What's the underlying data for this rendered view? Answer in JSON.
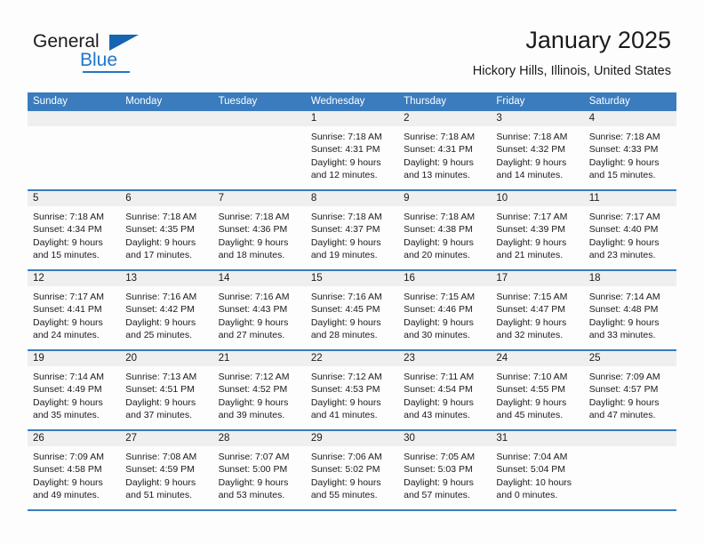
{
  "brand": {
    "name_part1": "General",
    "name_part2": "Blue",
    "logo_icon": "triangle-icon"
  },
  "header": {
    "title": "January 2025",
    "subtitle": "Hickory Hills, Illinois, United States"
  },
  "colors": {
    "header_blue": "#3a7cbe",
    "brand_blue": "#2076c9",
    "date_strip_gray": "#efefef",
    "text": "#1b1b1b"
  },
  "weekdays": [
    "Sunday",
    "Monday",
    "Tuesday",
    "Wednesday",
    "Thursday",
    "Friday",
    "Saturday"
  ],
  "weeks": [
    [
      {
        "date": "",
        "sunrise": "",
        "sunset": "",
        "daylight_line1": "",
        "daylight_line2": ""
      },
      {
        "date": "",
        "sunrise": "",
        "sunset": "",
        "daylight_line1": "",
        "daylight_line2": ""
      },
      {
        "date": "",
        "sunrise": "",
        "sunset": "",
        "daylight_line1": "",
        "daylight_line2": ""
      },
      {
        "date": "1",
        "sunrise": "Sunrise: 7:18 AM",
        "sunset": "Sunset: 4:31 PM",
        "daylight_line1": "Daylight: 9 hours",
        "daylight_line2": "and 12 minutes."
      },
      {
        "date": "2",
        "sunrise": "Sunrise: 7:18 AM",
        "sunset": "Sunset: 4:31 PM",
        "daylight_line1": "Daylight: 9 hours",
        "daylight_line2": "and 13 minutes."
      },
      {
        "date": "3",
        "sunrise": "Sunrise: 7:18 AM",
        "sunset": "Sunset: 4:32 PM",
        "daylight_line1": "Daylight: 9 hours",
        "daylight_line2": "and 14 minutes."
      },
      {
        "date": "4",
        "sunrise": "Sunrise: 7:18 AM",
        "sunset": "Sunset: 4:33 PM",
        "daylight_line1": "Daylight: 9 hours",
        "daylight_line2": "and 15 minutes."
      }
    ],
    [
      {
        "date": "5",
        "sunrise": "Sunrise: 7:18 AM",
        "sunset": "Sunset: 4:34 PM",
        "daylight_line1": "Daylight: 9 hours",
        "daylight_line2": "and 15 minutes."
      },
      {
        "date": "6",
        "sunrise": "Sunrise: 7:18 AM",
        "sunset": "Sunset: 4:35 PM",
        "daylight_line1": "Daylight: 9 hours",
        "daylight_line2": "and 17 minutes."
      },
      {
        "date": "7",
        "sunrise": "Sunrise: 7:18 AM",
        "sunset": "Sunset: 4:36 PM",
        "daylight_line1": "Daylight: 9 hours",
        "daylight_line2": "and 18 minutes."
      },
      {
        "date": "8",
        "sunrise": "Sunrise: 7:18 AM",
        "sunset": "Sunset: 4:37 PM",
        "daylight_line1": "Daylight: 9 hours",
        "daylight_line2": "and 19 minutes."
      },
      {
        "date": "9",
        "sunrise": "Sunrise: 7:18 AM",
        "sunset": "Sunset: 4:38 PM",
        "daylight_line1": "Daylight: 9 hours",
        "daylight_line2": "and 20 minutes."
      },
      {
        "date": "10",
        "sunrise": "Sunrise: 7:17 AM",
        "sunset": "Sunset: 4:39 PM",
        "daylight_line1": "Daylight: 9 hours",
        "daylight_line2": "and 21 minutes."
      },
      {
        "date": "11",
        "sunrise": "Sunrise: 7:17 AM",
        "sunset": "Sunset: 4:40 PM",
        "daylight_line1": "Daylight: 9 hours",
        "daylight_line2": "and 23 minutes."
      }
    ],
    [
      {
        "date": "12",
        "sunrise": "Sunrise: 7:17 AM",
        "sunset": "Sunset: 4:41 PM",
        "daylight_line1": "Daylight: 9 hours",
        "daylight_line2": "and 24 minutes."
      },
      {
        "date": "13",
        "sunrise": "Sunrise: 7:16 AM",
        "sunset": "Sunset: 4:42 PM",
        "daylight_line1": "Daylight: 9 hours",
        "daylight_line2": "and 25 minutes."
      },
      {
        "date": "14",
        "sunrise": "Sunrise: 7:16 AM",
        "sunset": "Sunset: 4:43 PM",
        "daylight_line1": "Daylight: 9 hours",
        "daylight_line2": "and 27 minutes."
      },
      {
        "date": "15",
        "sunrise": "Sunrise: 7:16 AM",
        "sunset": "Sunset: 4:45 PM",
        "daylight_line1": "Daylight: 9 hours",
        "daylight_line2": "and 28 minutes."
      },
      {
        "date": "16",
        "sunrise": "Sunrise: 7:15 AM",
        "sunset": "Sunset: 4:46 PM",
        "daylight_line1": "Daylight: 9 hours",
        "daylight_line2": "and 30 minutes."
      },
      {
        "date": "17",
        "sunrise": "Sunrise: 7:15 AM",
        "sunset": "Sunset: 4:47 PM",
        "daylight_line1": "Daylight: 9 hours",
        "daylight_line2": "and 32 minutes."
      },
      {
        "date": "18",
        "sunrise": "Sunrise: 7:14 AM",
        "sunset": "Sunset: 4:48 PM",
        "daylight_line1": "Daylight: 9 hours",
        "daylight_line2": "and 33 minutes."
      }
    ],
    [
      {
        "date": "19",
        "sunrise": "Sunrise: 7:14 AM",
        "sunset": "Sunset: 4:49 PM",
        "daylight_line1": "Daylight: 9 hours",
        "daylight_line2": "and 35 minutes."
      },
      {
        "date": "20",
        "sunrise": "Sunrise: 7:13 AM",
        "sunset": "Sunset: 4:51 PM",
        "daylight_line1": "Daylight: 9 hours",
        "daylight_line2": "and 37 minutes."
      },
      {
        "date": "21",
        "sunrise": "Sunrise: 7:12 AM",
        "sunset": "Sunset: 4:52 PM",
        "daylight_line1": "Daylight: 9 hours",
        "daylight_line2": "and 39 minutes."
      },
      {
        "date": "22",
        "sunrise": "Sunrise: 7:12 AM",
        "sunset": "Sunset: 4:53 PM",
        "daylight_line1": "Daylight: 9 hours",
        "daylight_line2": "and 41 minutes."
      },
      {
        "date": "23",
        "sunrise": "Sunrise: 7:11 AM",
        "sunset": "Sunset: 4:54 PM",
        "daylight_line1": "Daylight: 9 hours",
        "daylight_line2": "and 43 minutes."
      },
      {
        "date": "24",
        "sunrise": "Sunrise: 7:10 AM",
        "sunset": "Sunset: 4:55 PM",
        "daylight_line1": "Daylight: 9 hours",
        "daylight_line2": "and 45 minutes."
      },
      {
        "date": "25",
        "sunrise": "Sunrise: 7:09 AM",
        "sunset": "Sunset: 4:57 PM",
        "daylight_line1": "Daylight: 9 hours",
        "daylight_line2": "and 47 minutes."
      }
    ],
    [
      {
        "date": "26",
        "sunrise": "Sunrise: 7:09 AM",
        "sunset": "Sunset: 4:58 PM",
        "daylight_line1": "Daylight: 9 hours",
        "daylight_line2": "and 49 minutes."
      },
      {
        "date": "27",
        "sunrise": "Sunrise: 7:08 AM",
        "sunset": "Sunset: 4:59 PM",
        "daylight_line1": "Daylight: 9 hours",
        "daylight_line2": "and 51 minutes."
      },
      {
        "date": "28",
        "sunrise": "Sunrise: 7:07 AM",
        "sunset": "Sunset: 5:00 PM",
        "daylight_line1": "Daylight: 9 hours",
        "daylight_line2": "and 53 minutes."
      },
      {
        "date": "29",
        "sunrise": "Sunrise: 7:06 AM",
        "sunset": "Sunset: 5:02 PM",
        "daylight_line1": "Daylight: 9 hours",
        "daylight_line2": "and 55 minutes."
      },
      {
        "date": "30",
        "sunrise": "Sunrise: 7:05 AM",
        "sunset": "Sunset: 5:03 PM",
        "daylight_line1": "Daylight: 9 hours",
        "daylight_line2": "and 57 minutes."
      },
      {
        "date": "31",
        "sunrise": "Sunrise: 7:04 AM",
        "sunset": "Sunset: 5:04 PM",
        "daylight_line1": "Daylight: 10 hours",
        "daylight_line2": "and 0 minutes."
      },
      {
        "date": "",
        "sunrise": "",
        "sunset": "",
        "daylight_line1": "",
        "daylight_line2": ""
      }
    ]
  ]
}
